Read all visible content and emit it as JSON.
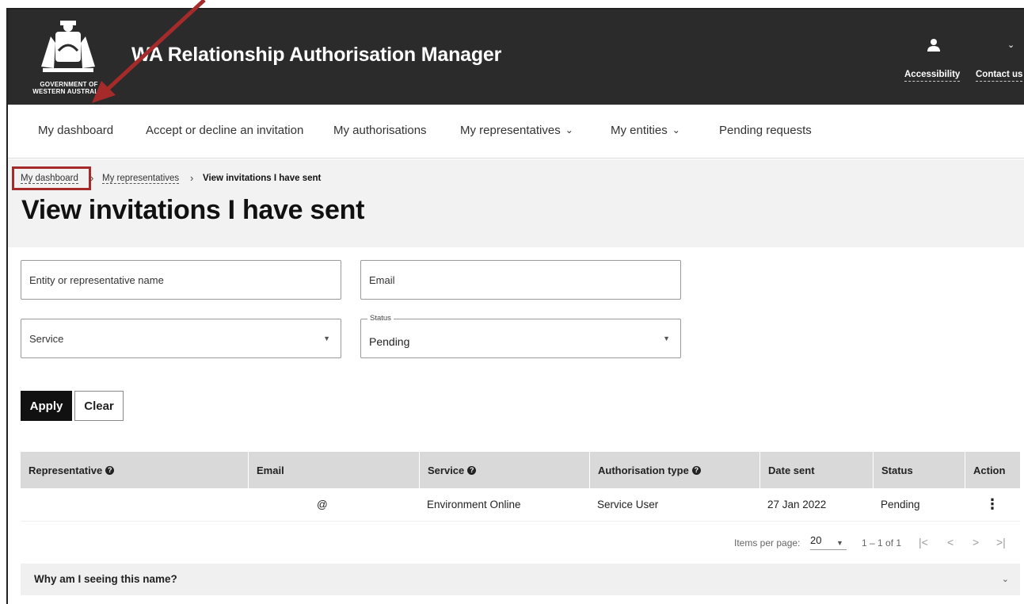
{
  "header": {
    "crest_text": [
      "GOVERNMENT OF",
      "WESTERN AUSTRALIA"
    ],
    "app_title": "WA Relationship Authorisation Manager",
    "accessibility": "Accessibility",
    "contact": "Contact us"
  },
  "nav": {
    "items": [
      {
        "label": "My dashboard"
      },
      {
        "label": "Accept or decline an invitation"
      },
      {
        "label": "My authorisations"
      },
      {
        "label": "My representatives"
      },
      {
        "label": "My entities"
      },
      {
        "label": "Pending requests"
      }
    ]
  },
  "breadcrumb": {
    "items": [
      "My dashboard",
      "My representatives",
      "View invitations I have sent"
    ]
  },
  "page_title": "View invitations I have sent",
  "filters": {
    "entity_placeholder": "Entity or representative name",
    "email_placeholder": "Email",
    "service_placeholder": "Service",
    "status_label": "Status",
    "status_value": "Pending",
    "apply": "Apply",
    "clear": "Clear"
  },
  "table": {
    "headers": [
      "Representative",
      "Email",
      "Service",
      "Authorisation type",
      "Date sent",
      "Status",
      "Action"
    ],
    "rows": [
      {
        "representative": "",
        "email": "@",
        "service": "Environment Online",
        "auth_type": "Service User",
        "date_sent": "27 Jan 2022",
        "status": "Pending"
      }
    ]
  },
  "pagination": {
    "items_per_page_label": "Items per page:",
    "items_per_page": "20",
    "range": "1 – 1 of 1"
  },
  "accordion": {
    "label": "Why am I seeing this name?"
  },
  "colors": {
    "header_bg": "#2b2b2b",
    "annotation": "#a52a2a"
  }
}
